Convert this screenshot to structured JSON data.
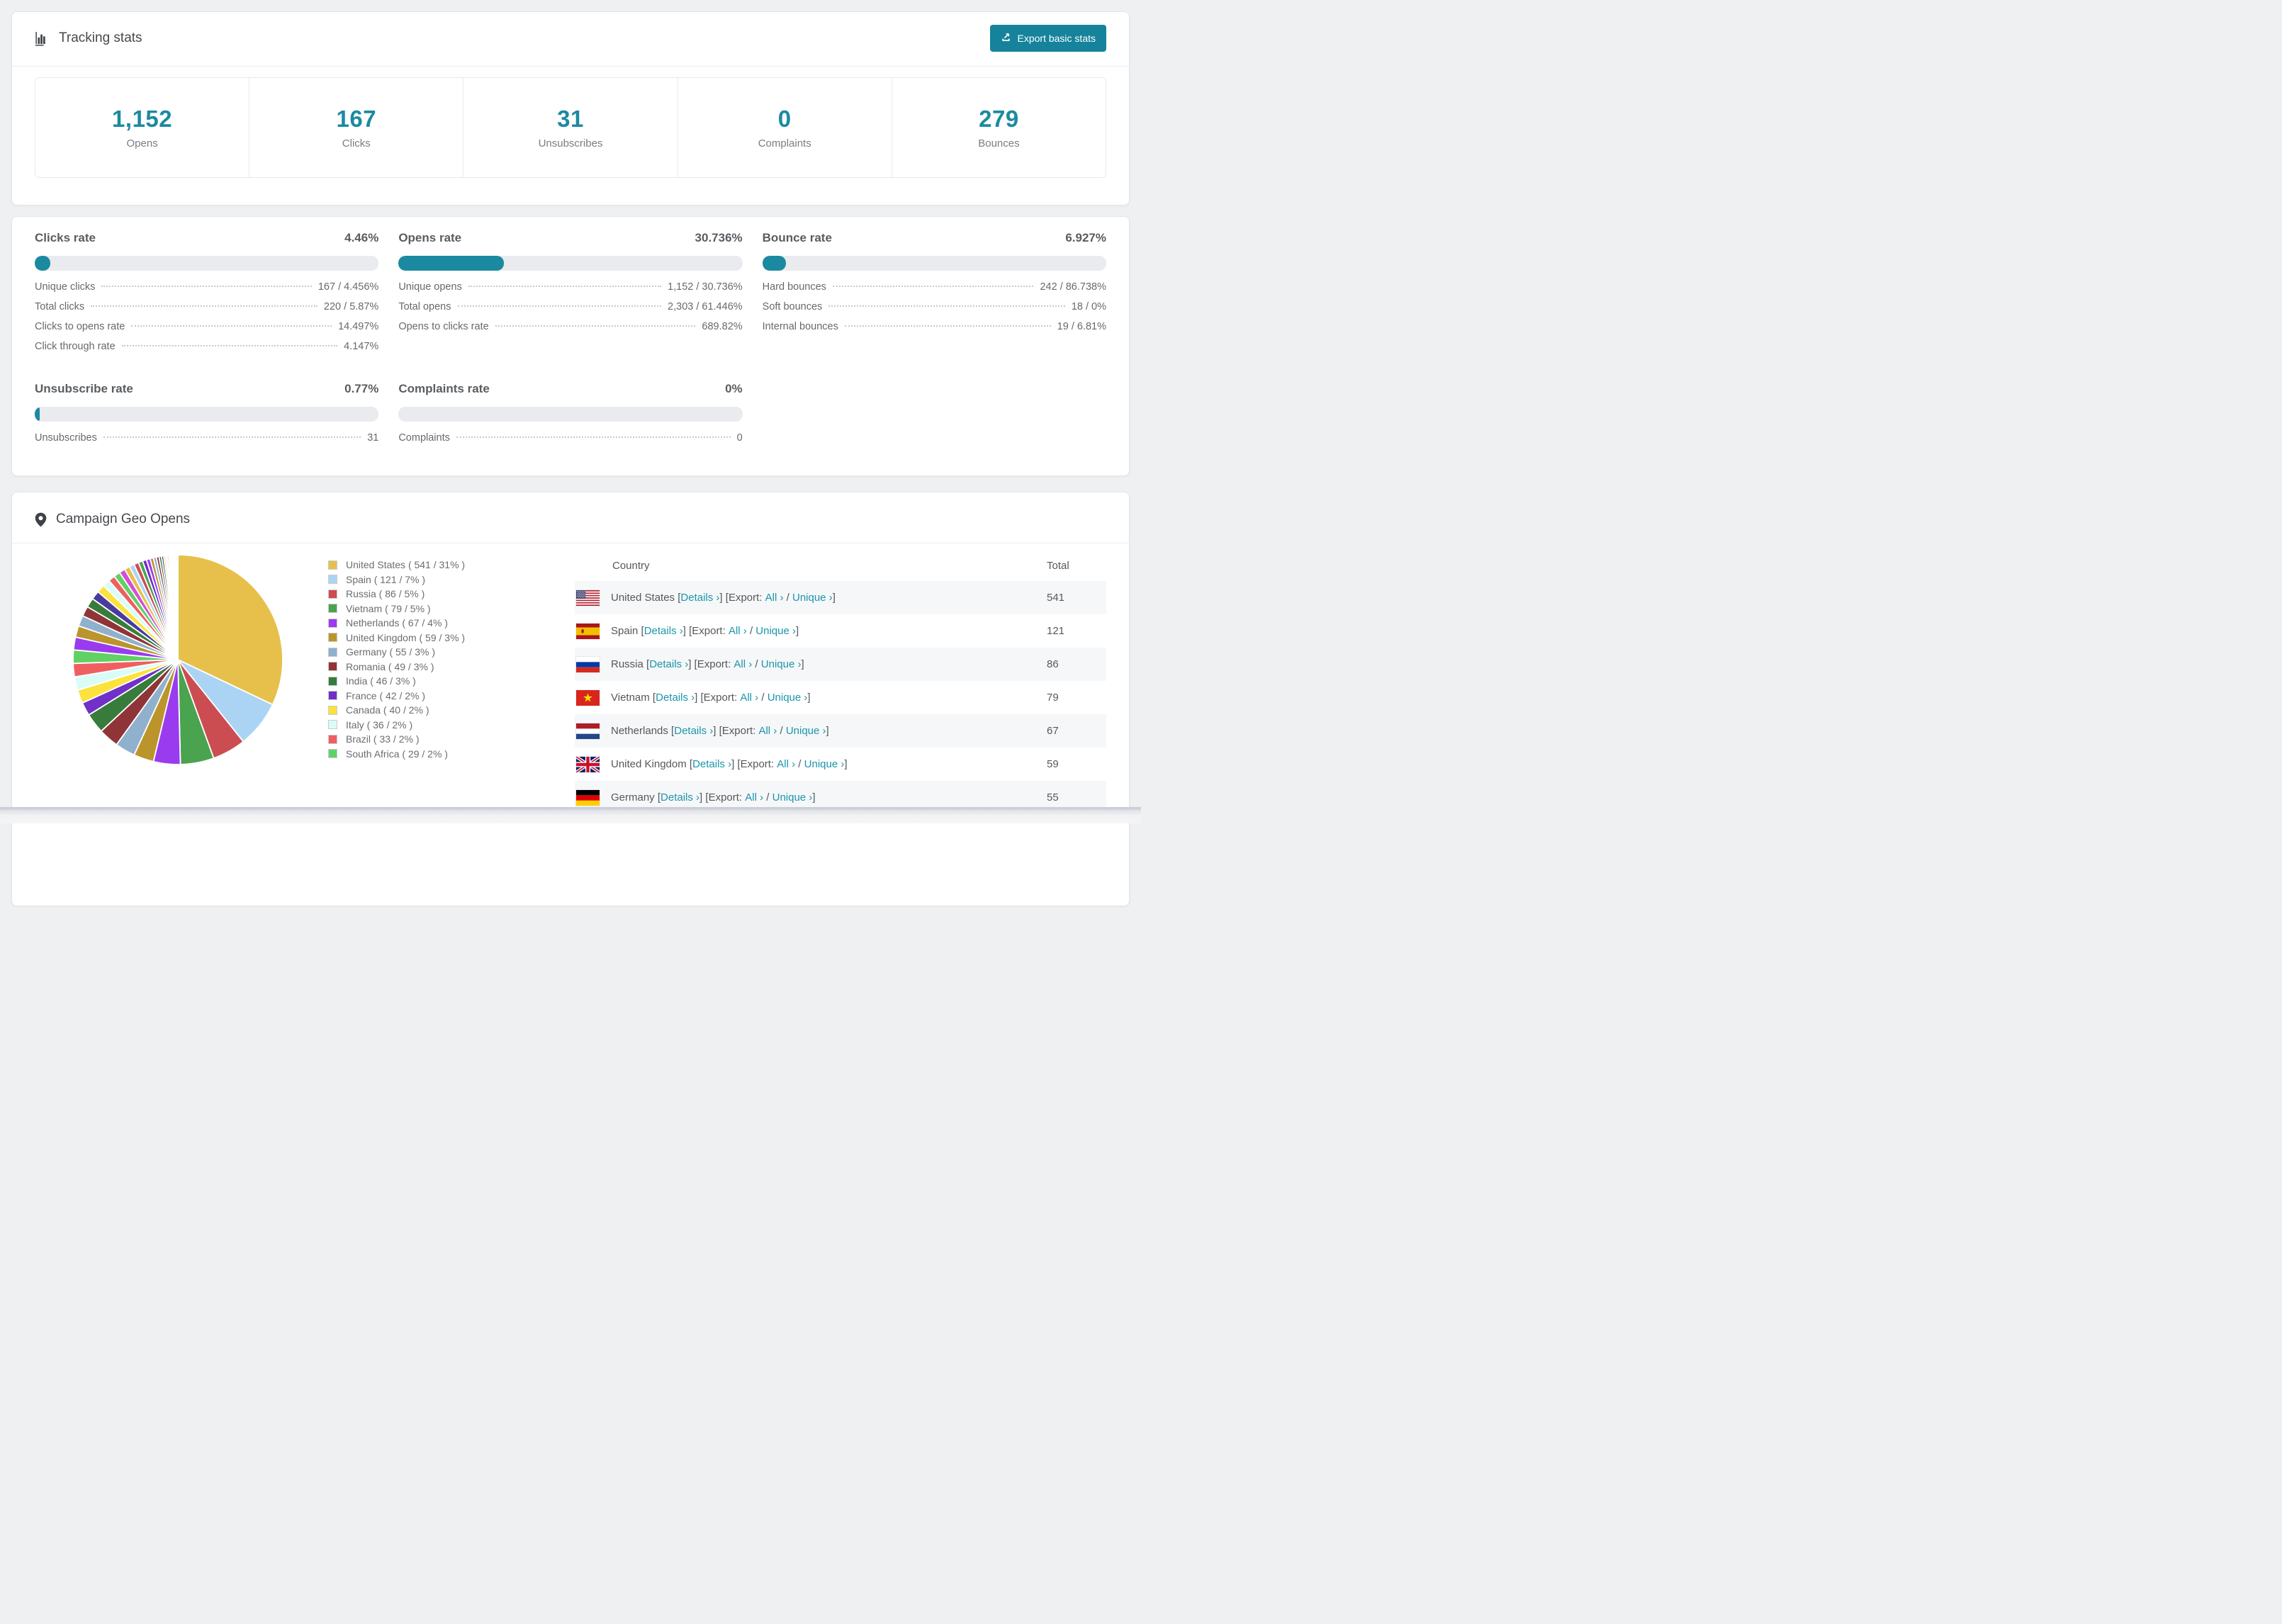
{
  "colors": {
    "accent_teal": "#1b8aa1",
    "button_teal": "#15839b",
    "link_teal": "#1b95ad",
    "bar_track": "#e9ebee",
    "row_stripe": "#f6f7f8"
  },
  "tracking": {
    "title": "Tracking stats",
    "export_button": "Export basic stats",
    "summary": [
      {
        "value": "1,152",
        "label": "Opens"
      },
      {
        "value": "167",
        "label": "Clicks"
      },
      {
        "value": "31",
        "label": "Unsubscribes"
      },
      {
        "value": "0",
        "label": "Complaints"
      },
      {
        "value": "279",
        "label": "Bounces"
      }
    ]
  },
  "rates": [
    {
      "title": "Clicks rate",
      "percent": "4.46%",
      "fill_percent": 4.46,
      "rows": [
        {
          "label": "Unique clicks",
          "value": "167 / 4.456%"
        },
        {
          "label": "Total clicks",
          "value": "220 / 5.87%"
        },
        {
          "label": "Clicks to opens rate",
          "value": "14.497%"
        },
        {
          "label": "Click through rate",
          "value": "4.147%"
        }
      ]
    },
    {
      "title": "Opens rate",
      "percent": "30.736%",
      "fill_percent": 30.736,
      "rows": [
        {
          "label": "Unique opens",
          "value": "1,152 / 30.736%"
        },
        {
          "label": "Total opens",
          "value": "2,303 / 61.446%"
        },
        {
          "label": "Opens to clicks rate",
          "value": "689.82%"
        }
      ]
    },
    {
      "title": "Bounce rate",
      "percent": "6.927%",
      "fill_percent": 6.927,
      "rows": [
        {
          "label": "Hard bounces",
          "value": "242 / 86.738%"
        },
        {
          "label": "Soft bounces",
          "value": "18 / 0%"
        },
        {
          "label": "Internal bounces",
          "value": "19 / 6.81%"
        }
      ]
    },
    {
      "title": "Unsubscribe rate",
      "percent": "0.77%",
      "fill_percent": 0.77,
      "rows": [
        {
          "label": "Unsubscribes",
          "value": "31"
        }
      ]
    },
    {
      "title": "Complaints rate",
      "percent": "0%",
      "fill_percent": 0,
      "rows": [
        {
          "label": "Complaints",
          "value": "0"
        }
      ]
    }
  ],
  "geo": {
    "title": "Campaign Geo Opens",
    "chart_data": {
      "type": "pie",
      "title": "Campaign Geo Opens",
      "legend_position": "right",
      "start_angle_deg": -90,
      "direction": "clockwise",
      "series": [
        {
          "name": "United States",
          "value": 541,
          "percent": 31,
          "color": "#e6c04a"
        },
        {
          "name": "Spain",
          "value": 121,
          "percent": 7,
          "color": "#abd4f4"
        },
        {
          "name": "Russia",
          "value": 86,
          "percent": 5,
          "color": "#cb4d51"
        },
        {
          "name": "Vietnam",
          "value": 79,
          "percent": 5,
          "color": "#4aa34f"
        },
        {
          "name": "Netherlands",
          "value": 67,
          "percent": 4,
          "color": "#9a3bf0"
        },
        {
          "name": "United Kingdom",
          "value": 59,
          "percent": 3,
          "color": "#bb952c"
        },
        {
          "name": "Germany",
          "value": 55,
          "percent": 3,
          "color": "#8fb1cd"
        },
        {
          "name": "Romania",
          "value": 49,
          "percent": 3,
          "color": "#8f3537"
        },
        {
          "name": "India",
          "value": 46,
          "percent": 3,
          "color": "#377c3b"
        },
        {
          "name": "France",
          "value": 42,
          "percent": 2,
          "color": "#7130c8"
        },
        {
          "name": "Canada",
          "value": 40,
          "percent": 2,
          "color": "#fbe23c"
        },
        {
          "name": "Italy",
          "value": 36,
          "percent": 2,
          "color": "#dafcf7"
        },
        {
          "name": "Brazil",
          "value": 33,
          "percent": 2,
          "color": "#f05f60"
        },
        {
          "name": "South Africa",
          "value": 29,
          "percent": 2,
          "color": "#61d065"
        }
      ],
      "others_estimated_percent": [
        1.9,
        1.7,
        1.6,
        1.5,
        1.4,
        1.3,
        1.2,
        1.1,
        1.0,
        0.95,
        0.9,
        0.8,
        0.75,
        0.7,
        0.65,
        0.6,
        0.55,
        0.5,
        0.45,
        0.4,
        0.36,
        0.32,
        0.28,
        0.25,
        0.22,
        0.19,
        0.17,
        0.15,
        0.13,
        0.11,
        0.1,
        0.09,
        0.08,
        0.07,
        0.06,
        0.05,
        0.05,
        0.04,
        0.04,
        0.03
      ],
      "others_palette_cycle": [
        "#9a3bf0",
        "#bb952c",
        "#8fb1cd",
        "#8f3537",
        "#377c3b",
        "#4b3a9e",
        "#fbe23c",
        "#dafcf7",
        "#f05f60",
        "#61d065",
        "#d44fd4",
        "#e6c04a",
        "#abd4f4",
        "#cb4d51",
        "#4aa34f",
        "#7130c8"
      ]
    },
    "legend": [
      {
        "label": "United States ( 541 / 31% )",
        "color": "#e6c04a"
      },
      {
        "label": "Spain ( 121 / 7% )",
        "color": "#abd4f4"
      },
      {
        "label": "Russia ( 86 / 5% )",
        "color": "#cb4d51"
      },
      {
        "label": "Vietnam ( 79 / 5% )",
        "color": "#4aa34f"
      },
      {
        "label": "Netherlands ( 67 / 4% )",
        "color": "#9a3bf0"
      },
      {
        "label": "United Kingdom ( 59 / 3% )",
        "color": "#bb952c"
      },
      {
        "label": "Germany ( 55 / 3% )",
        "color": "#8fb1cd"
      },
      {
        "label": "Romania ( 49 / 3% )",
        "color": "#8f3537"
      },
      {
        "label": "India ( 46 / 3% )",
        "color": "#377c3b"
      },
      {
        "label": "France ( 42 / 2% )",
        "color": "#7130c8"
      },
      {
        "label": "Canada ( 40 / 2% )",
        "color": "#fbe23c"
      },
      {
        "label": "Italy ( 36 / 2% )",
        "color": "#dafcf7"
      },
      {
        "label": "Brazil ( 33 / 2% )",
        "color": "#f05f60"
      },
      {
        "label": "South Africa ( 29 / 2% )",
        "color": "#61d065"
      }
    ],
    "table": {
      "headers": [
        "Country",
        "Total"
      ],
      "link_labels": {
        "details": "Details",
        "export": "Export:",
        "all": "All",
        "unique": "Unique",
        "chevron": "›"
      },
      "rows": [
        {
          "country": "United States",
          "flag": "us",
          "total": "541"
        },
        {
          "country": "Spain",
          "flag": "es",
          "total": "121"
        },
        {
          "country": "Russia",
          "flag": "ru",
          "total": "86"
        },
        {
          "country": "Vietnam",
          "flag": "vn",
          "total": "79"
        },
        {
          "country": "Netherlands",
          "flag": "nl",
          "total": "67"
        },
        {
          "country": "United Kingdom",
          "flag": "gb",
          "total": "59"
        },
        {
          "country": "Germany",
          "flag": "de",
          "total": "55"
        }
      ]
    }
  }
}
